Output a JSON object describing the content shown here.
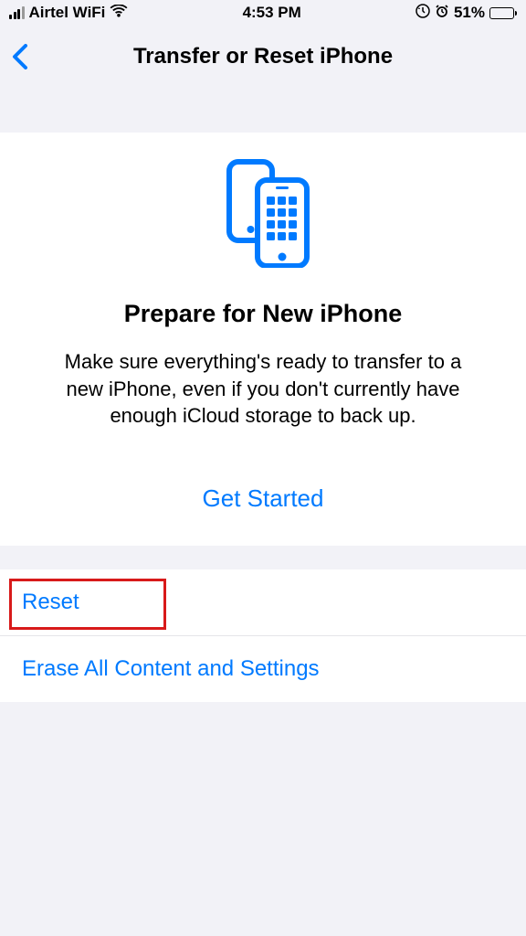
{
  "status": {
    "carrier": "Airtel WiFi",
    "time": "4:53 PM",
    "battery": "51%"
  },
  "nav": {
    "title": "Transfer or Reset iPhone"
  },
  "hero": {
    "title": "Prepare for New iPhone",
    "description": "Make sure everything's ready to transfer to a new iPhone, even if you don't currently have enough iCloud storage to back up.",
    "cta": "Get Started"
  },
  "options": {
    "reset": "Reset",
    "erase": "Erase All Content and Settings"
  },
  "colors": {
    "link": "#007aff",
    "highlight": "#d81a1a"
  }
}
